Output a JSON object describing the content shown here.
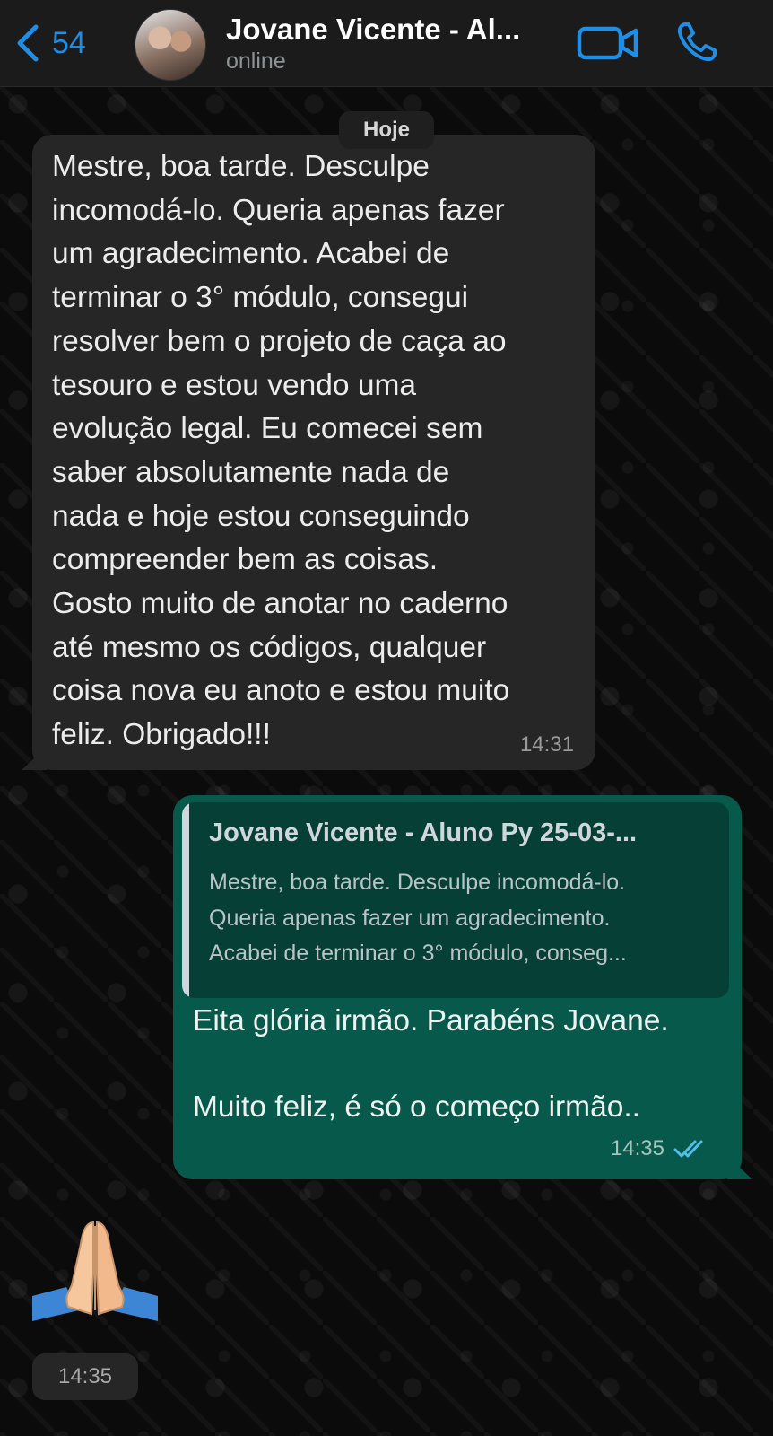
{
  "header": {
    "back_count": "54",
    "contact_name": "Jovane Vicente - Al...",
    "status": "online"
  },
  "chat": {
    "date_label": "Hoje",
    "incoming": {
      "text": "Mestre, boa tarde. Desculpe\nincomodá-lo. Queria apenas fazer\num agradecimento. Acabei de\nterminar o 3° módulo, consegui\nresolver bem o projeto de caça ao\ntesouro e estou vendo uma\nevolução legal. Eu comecei sem\nsaber absolutamente nada de\nnada e hoje estou conseguindo\ncompreender bem as coisas.\nGosto muito de anotar no caderno\naté mesmo os códigos, qualquer\ncoisa nova eu anoto e estou muito\nfeliz. Obrigado!!!",
      "time": "14:31"
    },
    "outgoing": {
      "quote_name": "Jovane Vicente - Aluno Py 25-03-...",
      "quote_text": "Mestre, boa tarde. Desculpe incomodá-lo.\nQueria apenas fazer um agradecimento.\nAcabei de terminar o 3° módulo, conseg...",
      "text": "Eita glória irmão. Parabéns Jovane.\n\nMuito feliz, é só o começo irmão..",
      "time": "14:35",
      "read_status": "read"
    },
    "emoji_message": {
      "emoji_name": "folded-hands",
      "time": "14:35"
    }
  },
  "colors": {
    "accent": "#1f8ee6",
    "incoming_bubble": "#262626",
    "outgoing_bubble": "#075a4b",
    "read_ticks": "#53bdeb"
  }
}
